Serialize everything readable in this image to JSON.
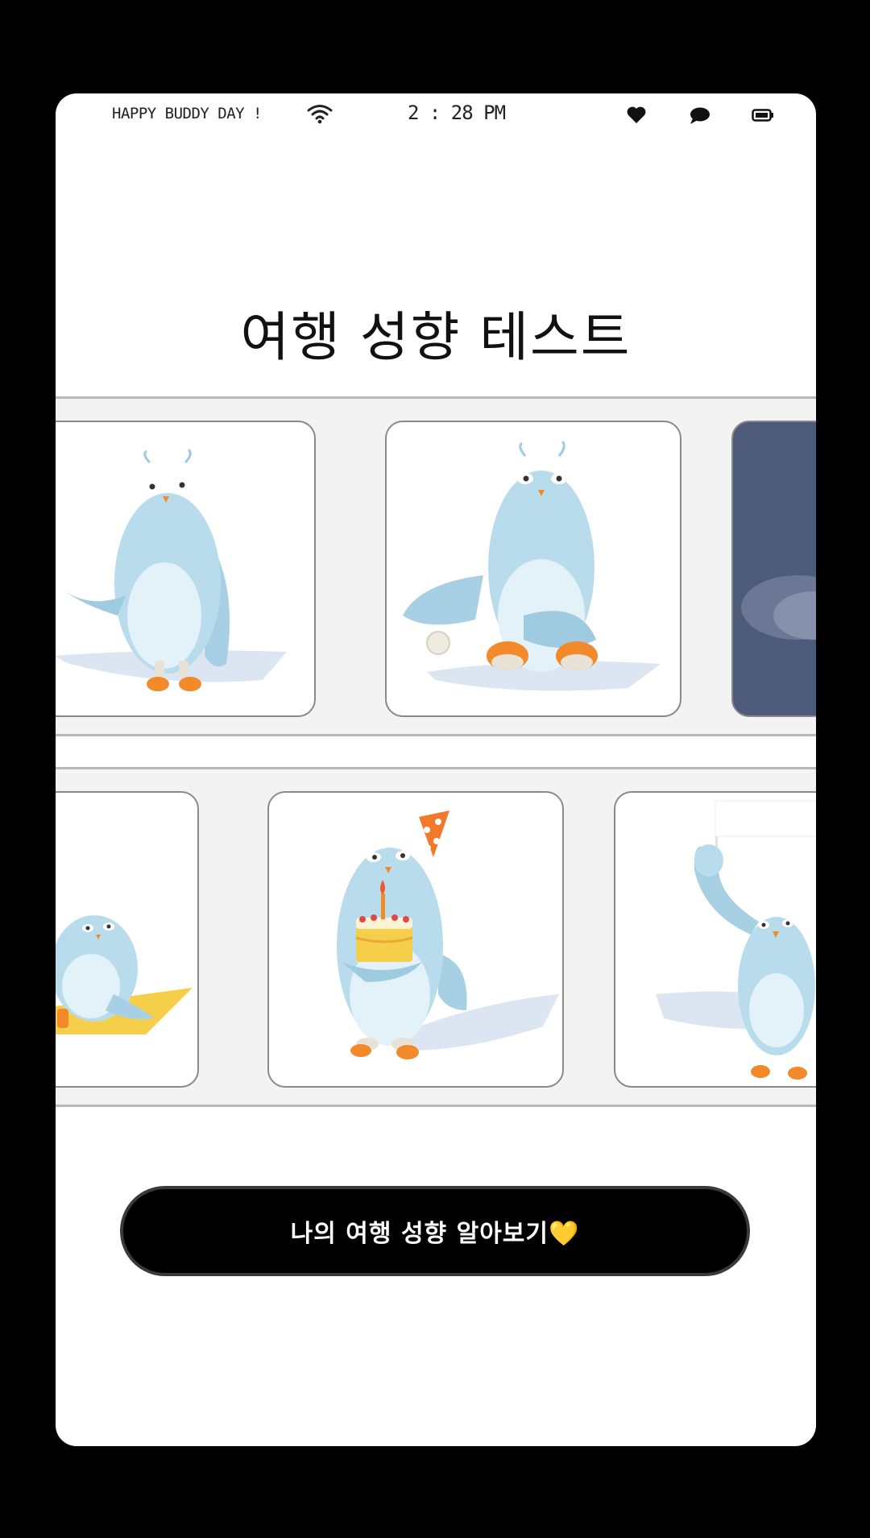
{
  "status_bar": {
    "greeting": "HAPPY BUDDY DAY !",
    "time": "2 : 28 PM",
    "icons": [
      "wifi-icon",
      "heart-icon",
      "chat-bubble-icon",
      "battery-icon"
    ]
  },
  "page": {
    "title": "여행 성향 테스트"
  },
  "carousel_top": {
    "items": [
      {
        "image": "bird-shrugging",
        "theme": "light"
      },
      {
        "image": "bird-sitting-with-ball",
        "theme": "light"
      },
      {
        "image": "bird-night-scene",
        "theme": "dark"
      }
    ]
  },
  "carousel_bottom": {
    "items": [
      {
        "image": "bird-on-yellow-mat",
        "theme": "light"
      },
      {
        "image": "bird-party-hat-cake",
        "theme": "light"
      },
      {
        "image": "bird-holding-flag",
        "theme": "light"
      }
    ]
  },
  "cta": {
    "label": "나의 여행 성향 알아보기💛"
  },
  "colors": {
    "background": "#000000",
    "screen": "#ffffff",
    "band": "#f3f3f3",
    "bird_body": "#b9dcec",
    "bird_belly": "#e3f1f9",
    "bird_feet": "#f28a2b",
    "button": "#000000",
    "dark_card": "#4d5a79"
  }
}
